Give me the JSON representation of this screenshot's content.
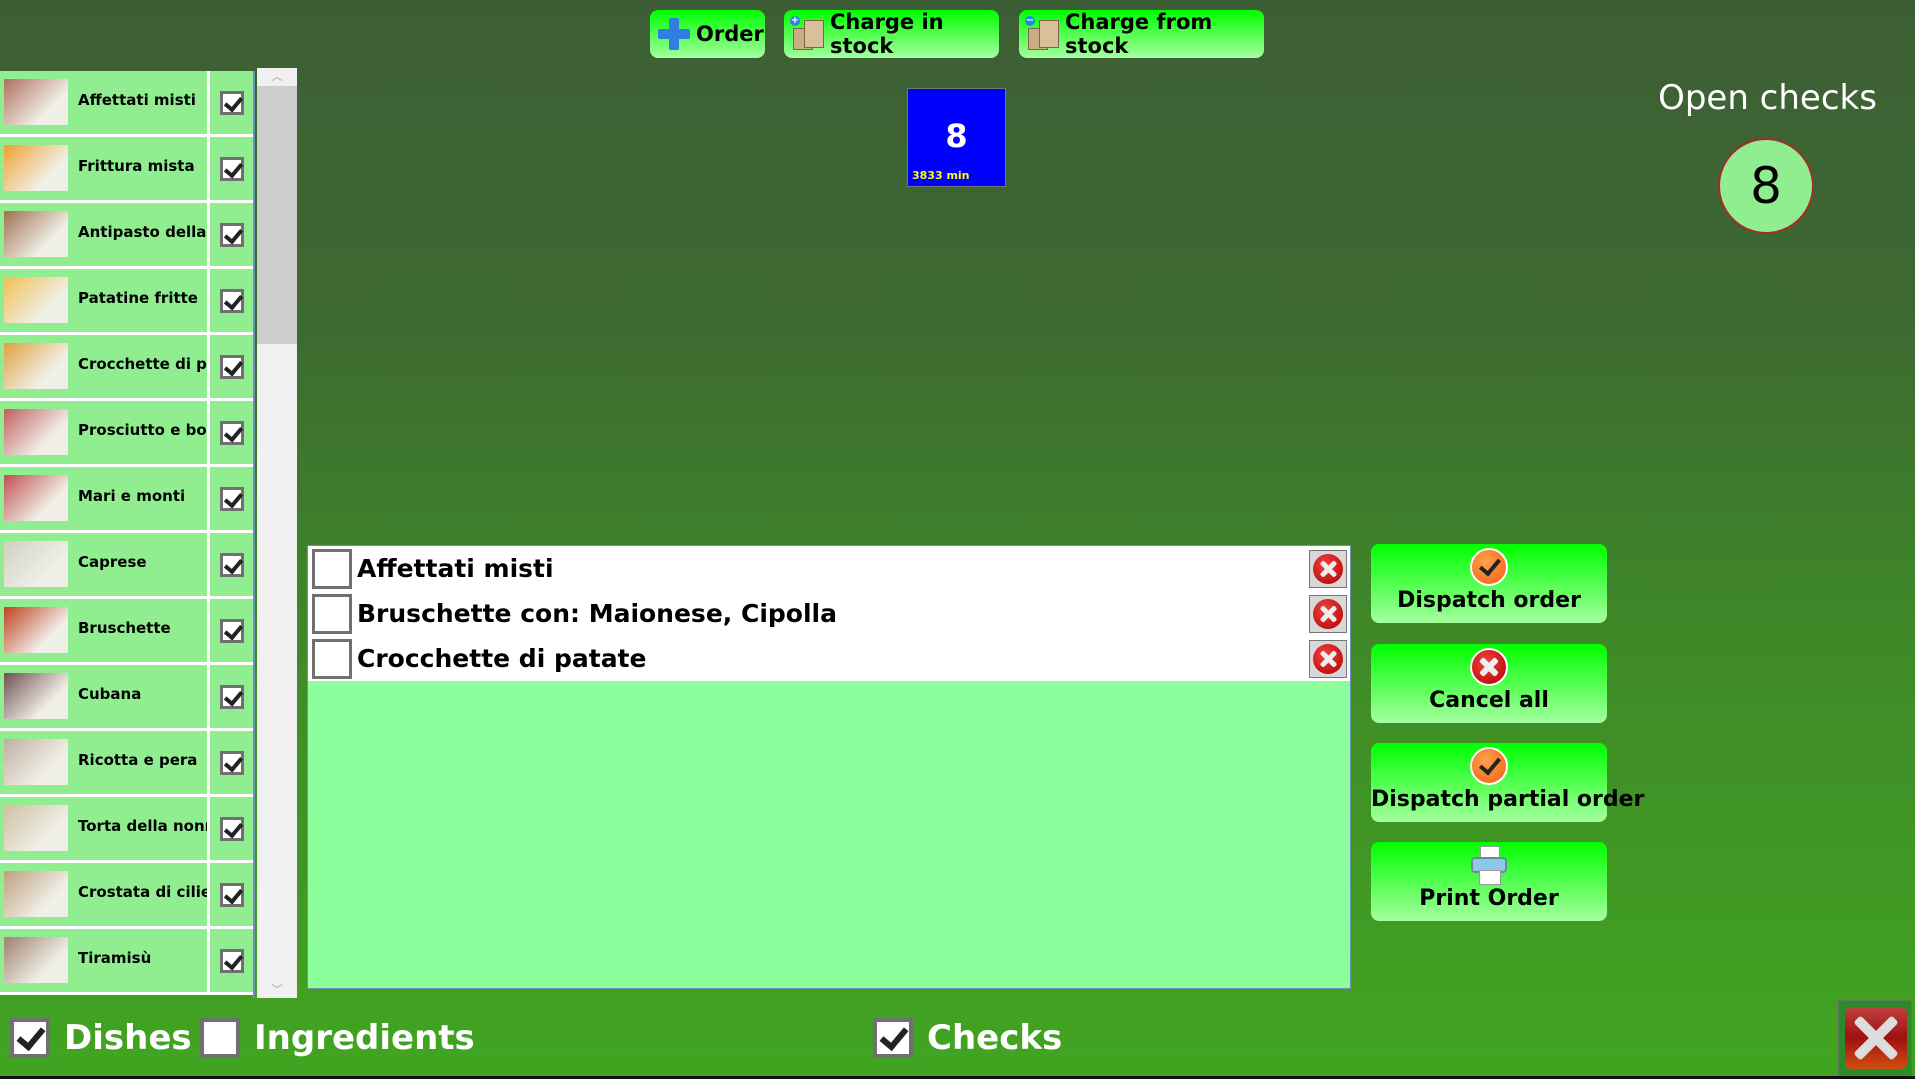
{
  "toolbar": {
    "order_label": "Order",
    "charge_in_label": "Charge in stock",
    "charge_from_label": "Charge from stock"
  },
  "dishes": [
    {
      "name": "Affettati misti",
      "checked": true,
      "thumb_color": "#b07060"
    },
    {
      "name": "Frittura mista",
      "checked": true,
      "thumb_color": "#f0a030"
    },
    {
      "name": "Antipasto della casa",
      "checked": true,
      "thumb_color": "#a07050"
    },
    {
      "name": "Patatine fritte",
      "checked": true,
      "thumb_color": "#f0c050"
    },
    {
      "name": "Crocchette di patate",
      "checked": true,
      "thumb_color": "#e0a040"
    },
    {
      "name": "Prosciutto e bocconcini",
      "checked": true,
      "thumb_color": "#c06060"
    },
    {
      "name": "Mari e monti",
      "checked": true,
      "thumb_color": "#c05050"
    },
    {
      "name": "Caprese",
      "checked": true,
      "thumb_color": "#d0d0c0"
    },
    {
      "name": "Bruschette",
      "checked": true,
      "thumb_color": "#c04020"
    },
    {
      "name": "Cubana",
      "checked": true,
      "thumb_color": "#705050"
    },
    {
      "name": "Ricotta e pera",
      "checked": true,
      "thumb_color": "#c0b0a0"
    },
    {
      "name": "Torta della nonna",
      "checked": true,
      "thumb_color": "#d0c0a0"
    },
    {
      "name": "Crostata di ciliegie",
      "checked": true,
      "thumb_color": "#c0a080"
    },
    {
      "name": "Tiramisù",
      "checked": true,
      "thumb_color": "#a08070"
    }
  ],
  "check_tile": {
    "number": "8",
    "elapsed": "3833 min",
    "color": "#0000ff"
  },
  "open_checks": {
    "title": "Open checks",
    "count": "8"
  },
  "order_items": [
    {
      "text": "Affettati misti",
      "checked": false
    },
    {
      "text": "Bruschette con: Maionese, Cipolla",
      "checked": false
    },
    {
      "text": "Crocchette di patate",
      "checked": false
    }
  ],
  "actions": {
    "dispatch_order": "Dispatch order",
    "cancel_all": "Cancel all",
    "dispatch_partial": "Dispatch partial order",
    "print_order": "Print Order"
  },
  "filters": {
    "dishes": {
      "label": "Dishes",
      "checked": true
    },
    "ingredients": {
      "label": "Ingredients",
      "checked": false
    },
    "checks": {
      "label": "Checks",
      "checked": true
    }
  }
}
